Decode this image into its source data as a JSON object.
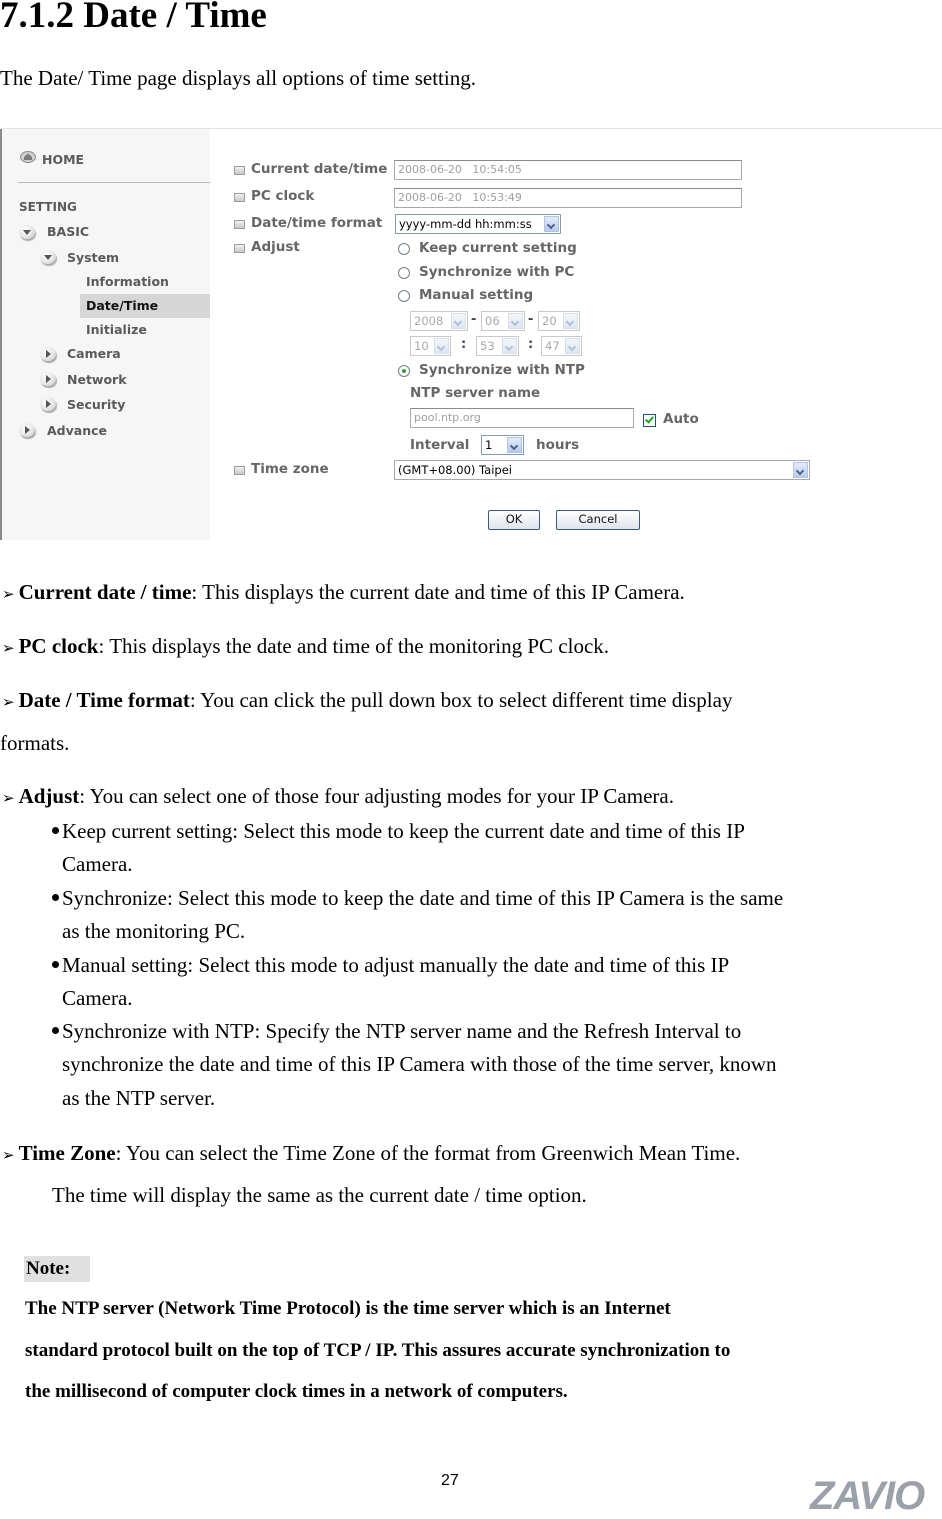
{
  "heading": "7.1.2 Date / Time",
  "intro": "The Date/ Time page displays all options of time setting.",
  "screenshot": {
    "sidebar": {
      "home": "HOME",
      "setting": "SETTING",
      "basic": "BASIC",
      "system": "System",
      "information": "Information",
      "date_time": "Date/Time",
      "initialize": "Initialize",
      "camera": "Camera",
      "network": "Network",
      "security": "Security",
      "advance": "Advance"
    },
    "form": {
      "current_label": "Current date/time",
      "current_value": "2008-06-20   10:54:05",
      "pc_label": "PC clock",
      "pc_value": "2008-06-20   10:53:49",
      "format_label": "Date/time format",
      "format_value": "yyyy-mm-dd hh:mm:ss",
      "adjust_label": "Adjust",
      "opt_keep": "Keep current setting",
      "opt_sync_pc": "Synchronize with PC",
      "opt_manual": "Manual setting",
      "opt_ntp": "Synchronize with NTP",
      "selected_option": "Synchronize with NTP",
      "manual": {
        "year": "2008",
        "month": "06",
        "day": "20",
        "hour": "10",
        "minute": "53",
        "second": "47",
        "date_sep": "-",
        "time_sep": ":"
      },
      "ntp_server_label": "NTP server name",
      "ntp_server_value": "pool.ntp.org",
      "auto_label": "Auto",
      "auto_checked": true,
      "interval_label": "Interval",
      "interval_value": "1",
      "interval_unit": "hours",
      "timezone_label": "Time zone",
      "timezone_value": "(GMT+08.00) Taipei",
      "ok": "OK",
      "cancel": "Cancel"
    }
  },
  "items": {
    "current_term": "Current date / time",
    "current_desc": ": This displays the current date and time of this IP Camera.",
    "pc_term": "PC clock",
    "pc_desc": ": This displays the date and time of the monitoring PC clock.",
    "format_term": "Date / Time format",
    "format_desc": ": You can click the pull down box to select different time display",
    "format_desc2": "formats.",
    "adjust_term": "Adjust",
    "adjust_desc": ": You can select one of those four adjusting modes for your IP Camera.",
    "adjust_bullets": [
      [
        "Keep current setting: Select this mode to keep the current date and time of this IP",
        "Camera."
      ],
      [
        "Synchronize: Select this mode to keep the date and time of this IP Camera is the same",
        "as the monitoring PC."
      ],
      [
        "Manual setting: Select this mode to adjust manually the date and time of this IP",
        "Camera."
      ],
      [
        "Synchronize with NTP: Specify the NTP server name and the Refresh Interval to",
        "synchronize the date and time of this IP Camera with those of the time server, known",
        "as the NTP server."
      ]
    ],
    "tz_term": "Time Zone",
    "tz_desc": ": You can select the Time Zone of the format from Greenwich Mean Time.",
    "tz_desc2": "The time will display the same as the current date / time option."
  },
  "note": {
    "label": "Note:",
    "lines": [
      "The NTP server (Network Time Protocol) is the time server which is an Internet",
      "standard protocol built on the top of TCP / IP. This assures accurate synchronization to",
      "the millisecond of computer clock times in a network of computers."
    ]
  },
  "page_number": "27",
  "logo": "ZAVIO"
}
